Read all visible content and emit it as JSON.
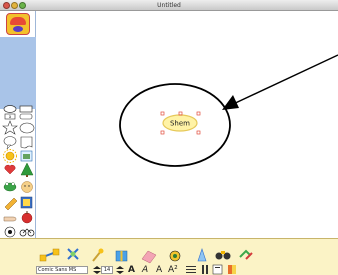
{
  "window": {
    "title": "Untitled"
  },
  "canvas": {
    "node_label": "Shem"
  },
  "format_bar": {
    "font_name": "Comic Sans MS",
    "font_size": "14",
    "bold_label": "A",
    "italic_label": "A",
    "plain_label": "A",
    "superscript_label": "A²"
  },
  "colors": {
    "palette_blue": "#a9c4e8",
    "bottom_bar": "#fbf3c6",
    "node_fill": "#fff3a6",
    "node_border": "#e6c95a",
    "handle": "#e24a3a"
  }
}
